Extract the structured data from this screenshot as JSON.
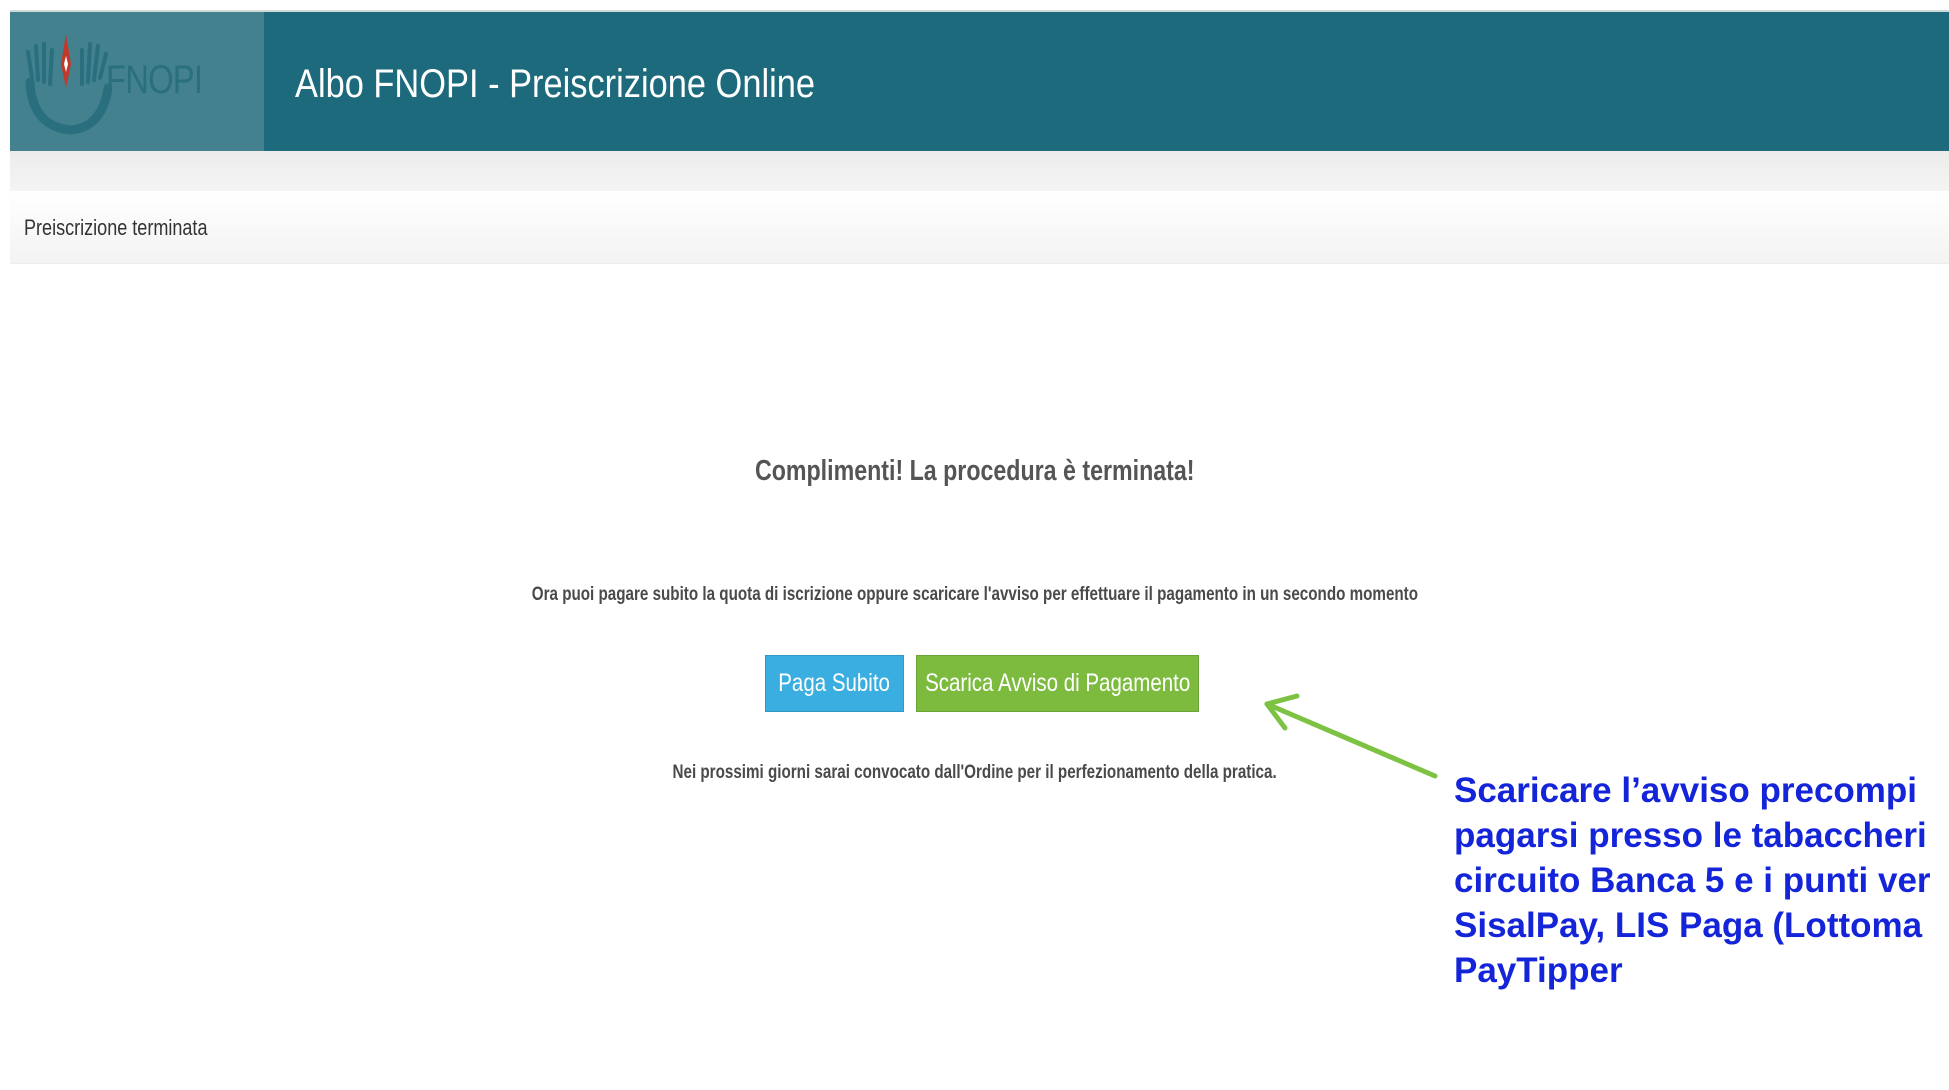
{
  "header": {
    "logo_text": "FNOPI",
    "title": "Albo FNOPI - Preiscrizione Online"
  },
  "breadcrumb": {
    "current": "Preiscrizione terminata"
  },
  "main": {
    "success_title": "Complimenti! La procedura è terminata!",
    "instruction": "Ora puoi pagare subito la quota di iscrizione oppure scaricare l'avviso per effettuare il pagamento in un secondo momento",
    "pay_now_label": "Paga Subito",
    "download_notice_label": "Scarica Avviso di Pagamento",
    "followup": "Nei prossimi giorni sarai convocato dall'Ordine per il perfezionamento della pratica."
  },
  "annotation": {
    "lines": [
      "Scaricare l’avviso  precompi",
      "pagarsi presso le tabaccheri",
      "circuito Banca 5 e i punti ver",
      "SisalPay, LIS Paga (Lottoma",
      "PayTipper"
    ],
    "arrow_icon": "arrow-pointer-icon"
  },
  "colors": {
    "header_bg": "#1c6a7c",
    "logo_bg": "#44818f",
    "pay_button": "#3aaee0",
    "download_button": "#7dbb3f",
    "annotation_text": "#1424d8",
    "annotation_arrow": "#7dc242"
  }
}
